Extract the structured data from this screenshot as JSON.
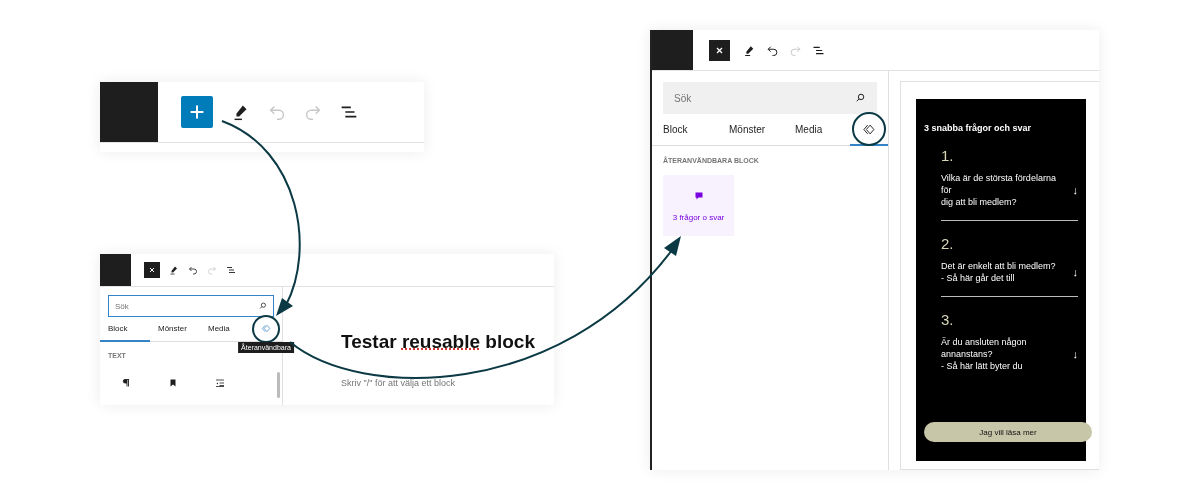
{
  "panels": [
    {
      "kind": "toolbar",
      "toolbar": {
        "undo_disabled": true,
        "redo_disabled": true
      }
    },
    {
      "kind": "editor",
      "toolbar": {
        "undo_disabled": false,
        "redo_disabled": true
      },
      "search": {
        "placeholder": "Sök",
        "focused": true
      },
      "tabs": [
        {
          "kind": "text",
          "label": "Block",
          "selected": true,
          "highlighted": false
        },
        {
          "kind": "text",
          "label": "Mönster",
          "selected": false,
          "highlighted": false
        },
        {
          "kind": "text",
          "label": "Media",
          "selected": false,
          "highlighted": false
        },
        {
          "kind": "icon",
          "selected": false,
          "highlighted": true
        }
      ],
      "tooltip": "Återanvändbara",
      "section_heading": "TEXT",
      "title": [
        {
          "text": "Testar "
        },
        {
          "text": "reusable",
          "misspelled": true
        },
        {
          "text": " block"
        }
      ],
      "hint": "Skriv \"/\" för att välja ett block"
    },
    {
      "kind": "editor",
      "toolbar": {
        "undo_disabled": false,
        "redo_disabled": true
      },
      "search": {
        "placeholder": "Sök",
        "focused": false
      },
      "tabs": [
        {
          "kind": "text",
          "label": "Block",
          "selected": false,
          "highlighted": false
        },
        {
          "kind": "text",
          "label": "Mönster",
          "selected": false,
          "highlighted": false
        },
        {
          "kind": "text",
          "label": "Media",
          "selected": false,
          "highlighted": false
        },
        {
          "kind": "icon",
          "selected": true,
          "highlighted": true
        }
      ],
      "section_heading": "ÅTERANVÄNDBARA BLOCK",
      "items": [
        {
          "label": "3 frågor o svar"
        }
      ],
      "preview": {
        "title": "3 snabba frågor och svar",
        "questions": [
          {
            "number": "1.",
            "lines": [
              "Vilka är de största fördelarna",
              "för",
              "dig att bli medlem?"
            ],
            "arrow": "↓"
          },
          {
            "number": "2.",
            "lines": [
              "Det är enkelt att bli medlem?",
              "- Så här går det till"
            ],
            "arrow": "↓"
          },
          {
            "number": "3.",
            "lines": [
              "Är du ansluten någon",
              "annanstans?",
              "- Så här lätt byter du"
            ],
            "arrow": "↓"
          }
        ],
        "button": "Jag vill läsa mer"
      }
    }
  ]
}
